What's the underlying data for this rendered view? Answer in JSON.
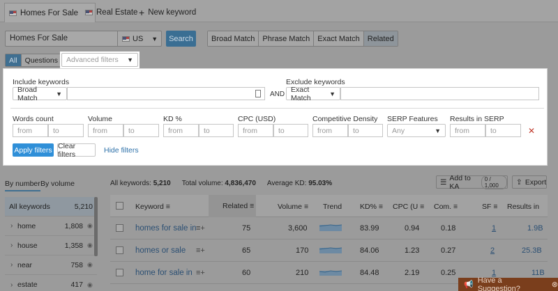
{
  "tabs": [
    {
      "label": "Homes For Sale",
      "active": true
    },
    {
      "label": "Real Estate",
      "active": false
    },
    {
      "label": "New keyword",
      "active": false
    }
  ],
  "search": {
    "keyword": "Homes For Sale",
    "database": "US",
    "search_button": "Search",
    "match_types": [
      "Broad Match",
      "Phrase Match",
      "Exact Match",
      "Related"
    ],
    "selected_match": "Related"
  },
  "segment": {
    "all": "All",
    "questions": "Questions"
  },
  "advanced_filters_placeholder": "Advanced filters",
  "filters": {
    "include_label": "Include keywords",
    "include_match": "Broad Match",
    "and_label": "AND",
    "exclude_label": "Exclude keywords",
    "exclude_match": "Exact Match",
    "ranges": [
      {
        "label": "Words count",
        "from": "from",
        "to": "to"
      },
      {
        "label": "Volume",
        "from": "from",
        "to": "to"
      },
      {
        "label": "KD %",
        "from": "from",
        "to": "to"
      },
      {
        "label": "CPC (USD)",
        "from": "from",
        "to": "to"
      },
      {
        "label": "Competitive Density",
        "from": "from",
        "to": "to"
      }
    ],
    "serp_label": "SERP Features",
    "serp_value": "Any",
    "results_label": "Results in SERP",
    "results_from": "from",
    "results_to": "to",
    "apply": "Apply filters",
    "clear": "Clear filters",
    "hide": "Hide filters"
  },
  "view_tabs": {
    "by_number": "By number",
    "by_volume": "By volume"
  },
  "summary": {
    "all_keywords_label": "All keywords:",
    "all_keywords_value": "5,210",
    "total_volume_label": "Total volume:",
    "total_volume_value": "4,836,470",
    "avg_kd_label": "Average KD:",
    "avg_kd_value": "95.03%"
  },
  "actions": {
    "add_to_ka": "Add to KA",
    "ka_count": "0 / 1,000",
    "export": "Export"
  },
  "groups": [
    {
      "name": "All keywords",
      "count": "5,210"
    },
    {
      "name": "home",
      "count": "1,808"
    },
    {
      "name": "house",
      "count": "1,358"
    },
    {
      "name": "near",
      "count": "758"
    },
    {
      "name": "estate",
      "count": "417"
    }
  ],
  "table": {
    "headers": {
      "keyword": "Keyword",
      "related": "Related",
      "volume": "Volume",
      "trend": "Trend",
      "kd": "KD%",
      "cpc": "CPC (U",
      "com": "Com.",
      "sf": "SF",
      "results": "Results in"
    },
    "rows": [
      {
        "keyword": "homes for sale in",
        "related": "75",
        "volume": "3,600",
        "kd": "83.99",
        "cpc": "0.94",
        "com": "0.18",
        "sf": "1",
        "results": "1.9B"
      },
      {
        "keyword": "homes or sale",
        "related": "65",
        "volume": "170",
        "kd": "84.06",
        "cpc": "1.23",
        "com": "0.27",
        "sf": "2",
        "results": "25.3B"
      },
      {
        "keyword": "home for sale in",
        "related": "60",
        "volume": "210",
        "kd": "84.48",
        "cpc": "2.19",
        "com": "0.25",
        "sf": "1",
        "results": "11B"
      }
    ]
  },
  "suggestion": "Have a Suggestion?"
}
